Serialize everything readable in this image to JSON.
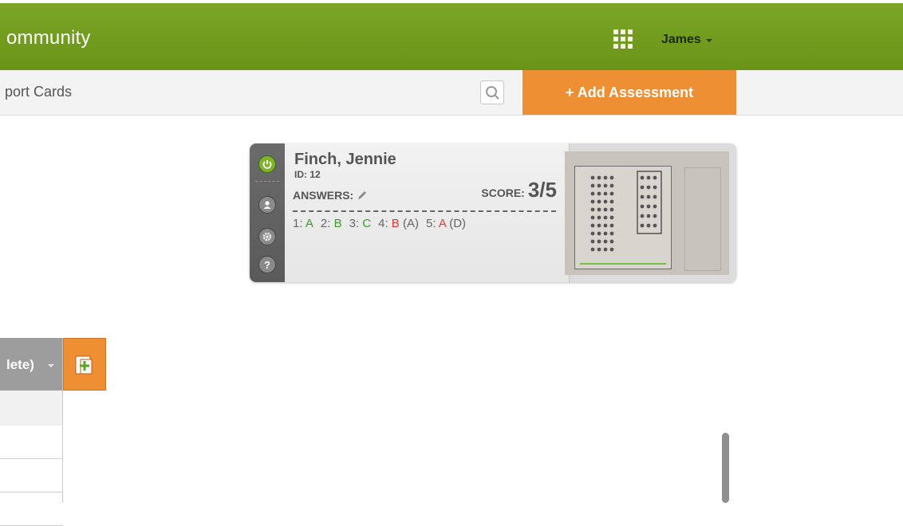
{
  "header": {
    "brand": "ommunity",
    "user": "James"
  },
  "subnav": {
    "title": "port Cards",
    "add_button": "+ Add Assessment"
  },
  "card": {
    "name": "Finch, Jennie",
    "id_line": "ID: 12",
    "answers_label": "ANSWERS:",
    "score_label": "SCORE:",
    "score_value": "3/5",
    "answers": [
      {
        "n": "1:",
        "a": "A",
        "status": "correct",
        "expected": ""
      },
      {
        "n": "2:",
        "a": "B",
        "status": "correct",
        "expected": ""
      },
      {
        "n": "3:",
        "a": "C",
        "status": "correct",
        "expected": ""
      },
      {
        "n": "4:",
        "a": "B",
        "status": "wrong",
        "expected": "(A)"
      },
      {
        "n": "5:",
        "a": "A",
        "status": "wrong",
        "expected": "(D)"
      }
    ]
  },
  "table": {
    "header_text": "lete)"
  },
  "colors": {
    "brand_green": "#6f9a1c",
    "accent_orange": "#ef8f34",
    "correct": "#3a9a2a",
    "wrong": "#e0392b"
  }
}
